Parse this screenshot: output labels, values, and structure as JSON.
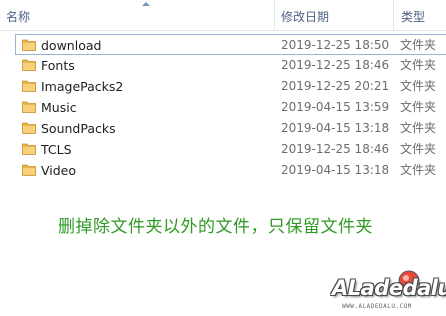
{
  "header": {
    "columns": [
      {
        "label": "名称"
      },
      {
        "label": "修改日期"
      },
      {
        "label": "类型"
      }
    ]
  },
  "files": [
    {
      "name": "download",
      "date": "2019-12-25 18:50",
      "type": "文件夹",
      "focused": true
    },
    {
      "name": "Fonts",
      "date": "2019-12-25 18:46",
      "type": "文件夹"
    },
    {
      "name": "ImagePacks2",
      "date": "2019-12-25 20:21",
      "type": "文件夹"
    },
    {
      "name": "Music",
      "date": "2019-04-15 13:59",
      "type": "文件夹"
    },
    {
      "name": "SoundPacks",
      "date": "2019-04-15 13:18",
      "type": "文件夹"
    },
    {
      "name": "TCLS",
      "date": "2019-12-25 18:46",
      "type": "文件夹"
    },
    {
      "name": "Video",
      "date": "2019-04-15 13:18",
      "type": "文件夹"
    }
  ],
  "caption": "删掉除文件夹以外的文件，只保留文件夹",
  "watermark": {
    "logo_text": "ALadedalu",
    "url_text": "WWW.ALADEDALU.COM"
  },
  "colors": {
    "header_text": "#4d6185",
    "caption": "#2e9a23",
    "folder": "#e8b64a"
  },
  "icons": {
    "folder": "folder-icon",
    "sort": "sort-ascending-icon"
  }
}
